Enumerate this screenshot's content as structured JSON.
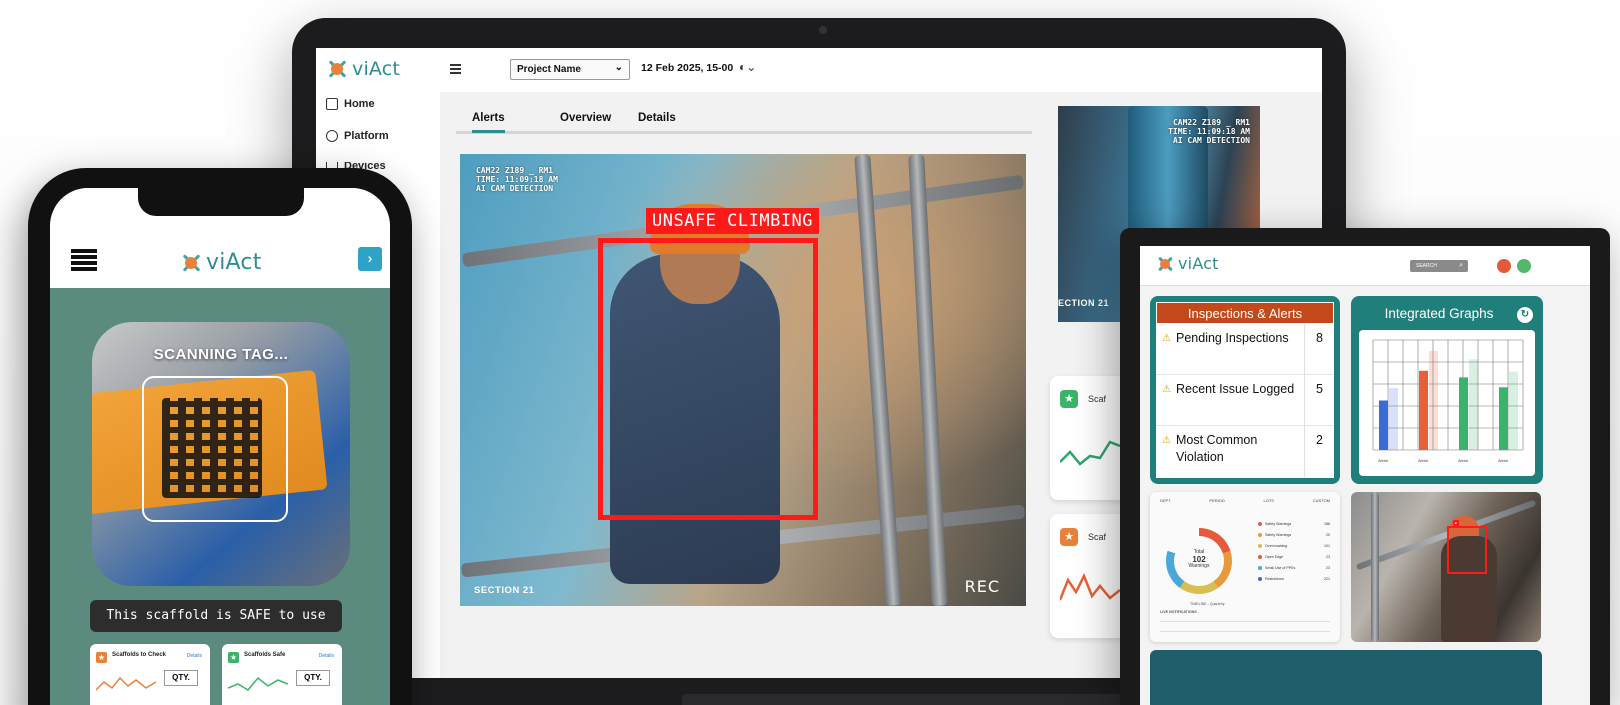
{
  "laptop": {
    "logo": "viAct",
    "nav": [
      {
        "label": "Home"
      },
      {
        "label": "Platform"
      },
      {
        "label": "Devices"
      }
    ],
    "project_select": "Project Name",
    "date": "12 Feb 2025, 15-00",
    "tabs": [
      {
        "label": "Alerts",
        "active": true
      },
      {
        "label": "Overview",
        "active": false
      },
      {
        "label": "Details",
        "active": false
      }
    ],
    "main_video": {
      "cam_line1": "CAM22 Z189 _ RM1",
      "cam_line2": "TIME: 11:09:18 AM",
      "cam_line3": "AI CAM DETECTION",
      "detection_label": "UNSAFE CLIMBING",
      "section": "SECTION 21",
      "rec": "REC"
    },
    "side_video": {
      "cam_line1": "CAM22 Z189 _ RM1",
      "cam_line2": "TIME: 11:09:18 AM",
      "cam_line3": "AI CAM DETECTION",
      "section": "ECTION 21"
    },
    "side_cards": [
      {
        "title": "Scaf",
        "icon": "star-icon",
        "color": "#3bb36a"
      },
      {
        "title": "Scaf",
        "icon": "star-icon",
        "color": "#e8823a"
      }
    ]
  },
  "phone": {
    "logo": "viAct",
    "scan_text": "SCANNING TAG...",
    "safe_message": "This scaffold is SAFE to use",
    "cards": [
      {
        "title": "Scaffolds to Check",
        "details": "Details",
        "qty": "QTY.",
        "color": "#e8823a"
      },
      {
        "title": "Scaffolds Safe",
        "details": "Details",
        "qty": "QTY.",
        "color": "#3bb36a"
      }
    ]
  },
  "tablet": {
    "logo": "viAct",
    "search_placeholder": "SEARCH",
    "inspections": {
      "title": "Inspections & Alerts",
      "rows": [
        {
          "label": "Pending Inspections",
          "value": "8"
        },
        {
          "label": "Recent Issue Logged",
          "value": "5"
        },
        {
          "label": "Most Common Violation",
          "value": "2"
        }
      ]
    },
    "graph": {
      "title": "Integrated Graphs",
      "bars": [
        {
          "color": "#3b6bd6",
          "value": 0.45
        },
        {
          "color": "#e8603a",
          "value": 0.72
        },
        {
          "color": "#3bb36a",
          "value": 0.66
        },
        {
          "color": "#3bb36a",
          "value": 0.57
        }
      ],
      "bar_labels": [
        "Week",
        "Week",
        "Week",
        "Week"
      ]
    },
    "dashboard": {
      "tabs": [
        "DEPT",
        "PERIOD",
        "LOTS",
        "CUSTOM"
      ],
      "total_label": "Total",
      "total_value": "102",
      "total_sub": "Warnings",
      "legend": [
        {
          "label": "Safety Warnings",
          "value": "186",
          "color": "#e55a3a"
        },
        {
          "label": "Safety Warnings",
          "value": "20",
          "color": "#e89a3a"
        },
        {
          "label": "Overcrowding",
          "value": "101",
          "color": "#d8c050"
        },
        {
          "label": "Open Edge",
          "value": "23",
          "color": "#e55a3a"
        },
        {
          "label": "Small Use of PPEs",
          "value": "23",
          "color": "#4aa7d8"
        },
        {
          "label": "Restrictions",
          "value": "221",
          "color": "#3b6bd6"
        }
      ],
      "timeline": "TIMELINE - Quarterly",
      "notifications_title": "LIVE NOTIFICATIONS"
    }
  }
}
